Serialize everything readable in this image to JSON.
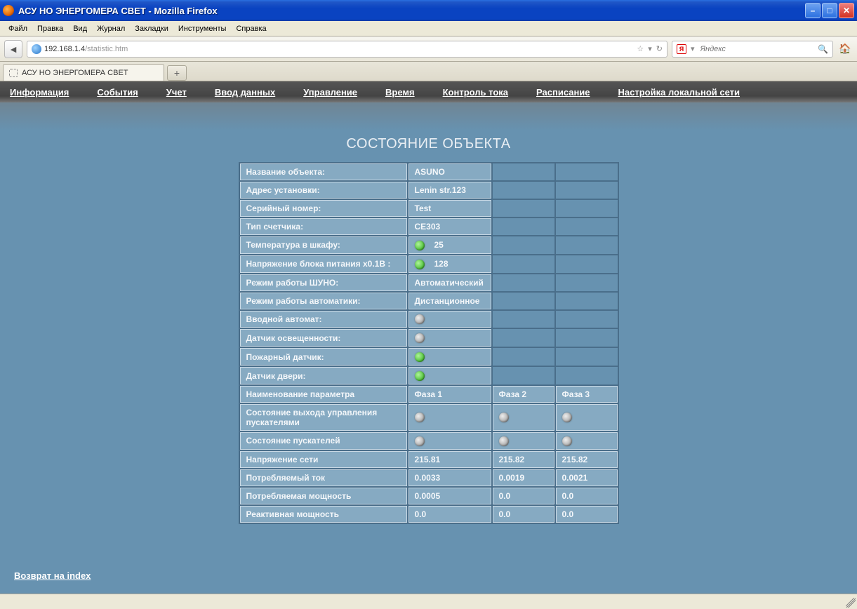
{
  "window": {
    "title": "АСУ НО ЭНЕРГОМЕРА СВЕТ - Mozilla Firefox"
  },
  "menubar": {
    "items": [
      "Файл",
      "Правка",
      "Вид",
      "Журнал",
      "Закладки",
      "Инструменты",
      "Справка"
    ]
  },
  "urlbar": {
    "host": "192.168.1.4",
    "path": "/statistic.htm"
  },
  "search": {
    "engine_badge": "Я",
    "placeholder": "Яндекс"
  },
  "tab": {
    "title": "АСУ НО ЭНЕРГОМЕРА СВЕТ"
  },
  "nav": {
    "items": [
      "Информация",
      "События",
      "Учет",
      "Ввод данных",
      "Управление",
      "Время",
      "Контроль тока",
      "Расписание",
      "Настройка локальной сети"
    ]
  },
  "page": {
    "title": "СОСТОЯНИЕ ОБЪЕКТА",
    "back_link": "Возврат на index"
  },
  "rows_simple": [
    {
      "label": "Название объекта:",
      "value": "ASUNO"
    },
    {
      "label": "Адрес установки:",
      "value": "Lenin str.123"
    },
    {
      "label": "Серийный номер:",
      "value": "Test"
    },
    {
      "label": "Тип счетчика:",
      "value": "CE303"
    }
  ],
  "rows_led_val": [
    {
      "label": "Температура в шкафу:",
      "led": "green",
      "value": "25"
    },
    {
      "label": "Напряжение блока питания x0.1В :",
      "led": "green",
      "value": "128"
    }
  ],
  "rows_mode": [
    {
      "label": "Режим работы ШУНО:",
      "value": "Автоматический"
    },
    {
      "label": "Режим работы автоматики:",
      "value": "Дистанционное"
    }
  ],
  "rows_sensor": [
    {
      "label": "Вводной автомат:",
      "led": "gray"
    },
    {
      "label": "Датчик освещенности:",
      "led": "gray"
    },
    {
      "label": "Пожарный датчик:",
      "led": "green"
    },
    {
      "label": "Датчик двери:",
      "led": "green"
    }
  ],
  "phase_header": {
    "label": "Наименование параметра",
    "p1": "Фаза 1",
    "p2": "Фаза 2",
    "p3": "Фаза 3"
  },
  "rows_phase_led": [
    {
      "label": "Состояние выхода управления пускателями",
      "p1": "gray",
      "p2": "gray",
      "p3": "gray"
    },
    {
      "label": "Состояние пускателей",
      "p1": "gray",
      "p2": "gray",
      "p3": "gray"
    }
  ],
  "rows_phase_val": [
    {
      "label": "Напряжение сети",
      "p1": "215.81",
      "p2": "215.82",
      "p3": "215.82"
    },
    {
      "label": "Потребляемый ток",
      "p1": "0.0033",
      "p2": "0.0019",
      "p3": "0.0021"
    },
    {
      "label": "Потребляемая мощность",
      "p1": "0.0005",
      "p2": "0.0",
      "p3": "0.0"
    },
    {
      "label": "Реактивная мощность",
      "p1": "0.0",
      "p2": "0.0",
      "p3": "0.0"
    }
  ]
}
